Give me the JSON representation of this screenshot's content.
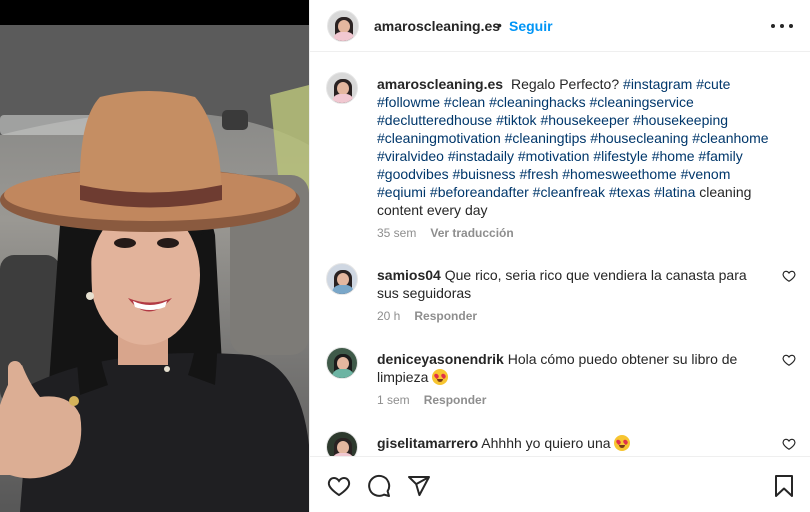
{
  "post": {
    "username": "amaroscleaning.es",
    "separator": "•",
    "follow_label": "Seguir",
    "more_label": "Más opciones"
  },
  "caption": {
    "username": "amaroscleaning.es",
    "text_plain": "Regalo Perfecto?",
    "hashtags": [
      "#instagram",
      "#cute",
      "#followme",
      "#clean",
      "#cleaninghacks",
      "#cleaningservice",
      "#declutteredhouse",
      "#tiktok",
      "#housekeeper",
      "#housekeeping",
      "#cleaningmotivation",
      "#cleaningtips",
      "#housecleaning",
      "#cleanhome",
      "#viralvideo",
      "#instadaily",
      "#motivation",
      "#lifestyle",
      "#home",
      "#family",
      "#goodvibes",
      "#buisness",
      "#fresh",
      "#homesweethome",
      "#venom",
      "#eqiumi",
      "#beforeandafter",
      "#cleanfreak",
      "#texas",
      "#latina"
    ],
    "text_tail": "cleaning content every day",
    "time": "35 sem",
    "translate_label": "Ver traducción"
  },
  "comments": [
    {
      "username": "samios04",
      "text": "Que rico, seria rico que vendiera la canasta para sus seguidoras",
      "time": "20 h",
      "reply_label": "Responder"
    },
    {
      "username": "deniceyasonendrik",
      "text": "Hola cómo puedo obtener su libro de limpieza",
      "emoji": "star-struck-emoji",
      "time": "1 sem",
      "reply_label": "Responder"
    },
    {
      "username": "giselitamarrero",
      "text": "Ahhhh yo quiero una",
      "emoji": "star-struck-emoji"
    }
  ],
  "icons": {
    "like": "heart-icon",
    "comment": "comment-icon",
    "share": "share-icon",
    "save": "bookmark-icon",
    "more": "more-dots-icon"
  },
  "colors": {
    "link": "#0095f6",
    "hashtag": "#00376b",
    "muted": "#8e8e8e",
    "text": "#262626"
  }
}
